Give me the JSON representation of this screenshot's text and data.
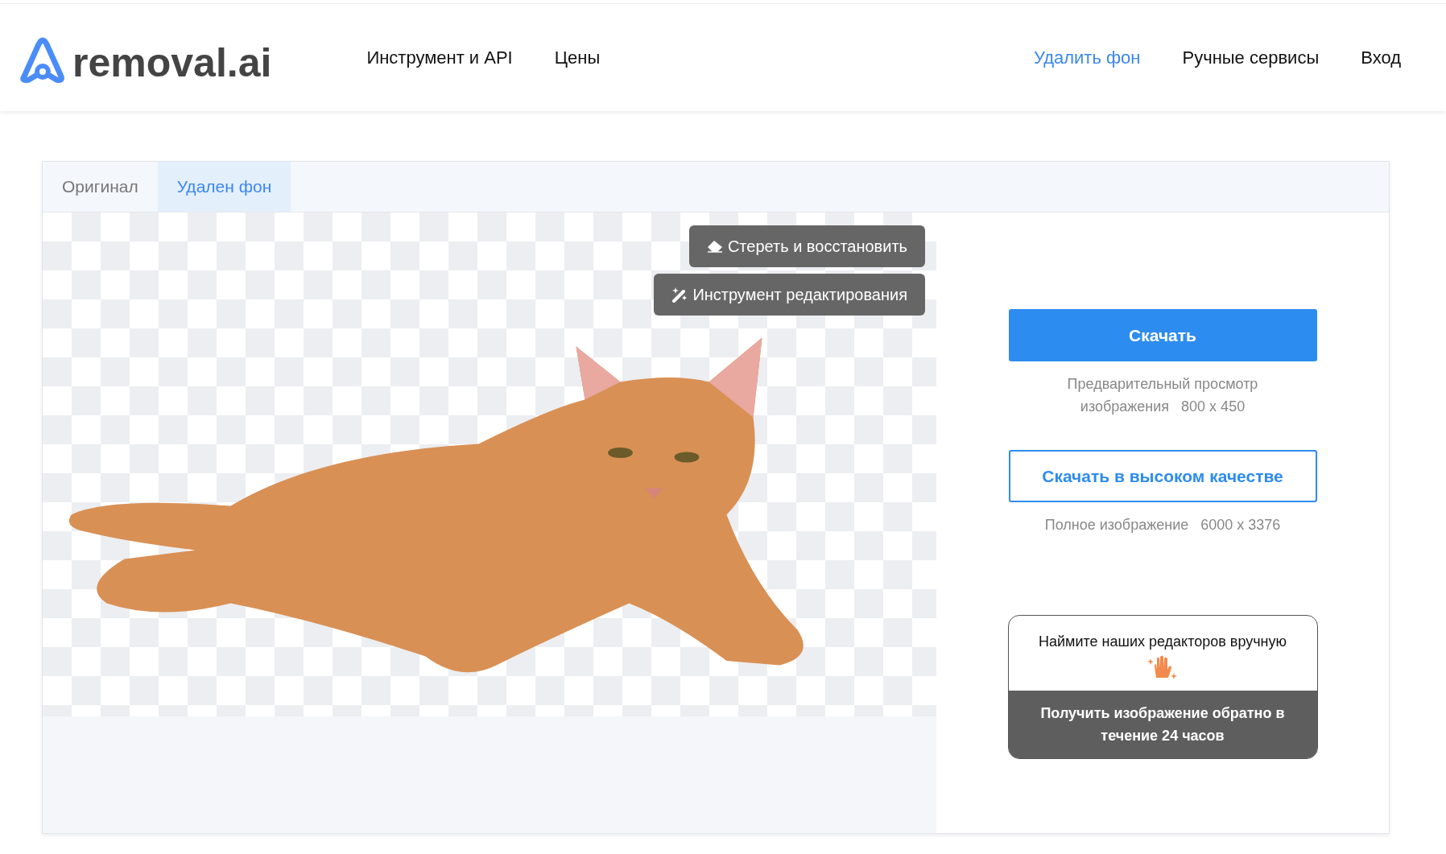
{
  "header": {
    "logo": "removal.ai",
    "nav_left": [
      {
        "label": "Инструмент и API",
        "selected": false
      },
      {
        "label": "Цены",
        "selected": false
      }
    ],
    "nav_right": [
      {
        "label": "Удалить фон",
        "selected": true
      },
      {
        "label": "Ручные сервисы",
        "selected": false
      },
      {
        "label": "Вход",
        "selected": false
      }
    ]
  },
  "tabs": [
    {
      "label": "Оригинал",
      "selected": false
    },
    {
      "label": "Удален фон",
      "selected": true
    }
  ],
  "edit_tools": [
    {
      "kind": "eraser",
      "label": "Стереть и восстановить"
    },
    {
      "kind": "wand",
      "label": "Инструмент редактирования"
    }
  ],
  "downloads": [
    {
      "kind": "primary",
      "label": "Скачать",
      "note": "Предварительный просмотр изображения",
      "size": "800 x 450"
    },
    {
      "kind": "outline",
      "label": "Скачать в высоком качестве",
      "note": "Полное изображение",
      "size": "6000 x 3376"
    }
  ],
  "hire_card": {
    "title": "Наймите наших редакторов вручную",
    "action": "Получить изображение обратно в течение 24 часов"
  }
}
